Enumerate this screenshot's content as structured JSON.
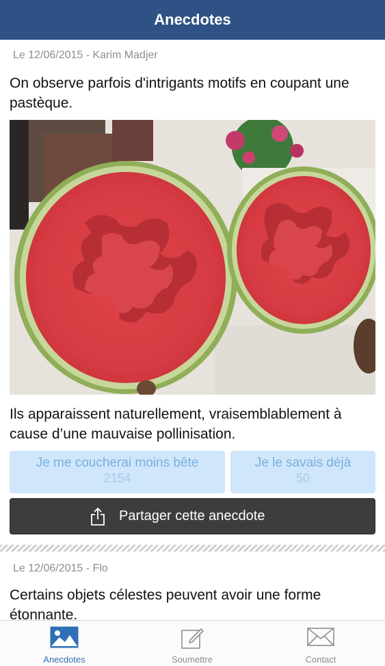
{
  "navbar": {
    "title": "Anecdotes"
  },
  "posts": [
    {
      "meta": "Le 12/06/2015 - Karim Madjer",
      "text": "On observe parfois d'intrigants motifs en coupant une pastèque.",
      "explanation": "Ils apparaissent naturellement, vraisemblablement à cause d’une mauvaise pollinisation.",
      "vote_learned": {
        "label": "Je me coucherai moins bête",
        "count": "2154"
      },
      "vote_known": {
        "label": "Je le savais déjà",
        "count": "50"
      },
      "share_label": "Partager cette anecdote"
    },
    {
      "meta": "Le 12/06/2015 - Flo",
      "text": "Certains objets célestes peuvent avoir une forme étonnante."
    }
  ],
  "tabbar": {
    "items": [
      {
        "label": "Anecdotes",
        "icon": "image-icon",
        "active": true
      },
      {
        "label": "Soumettre",
        "icon": "compose-icon",
        "active": false
      },
      {
        "label": "Contact",
        "icon": "mail-icon",
        "active": false
      }
    ]
  },
  "colors": {
    "navbar": "#2f5286",
    "accent": "#2f6fb6",
    "vote_bg": "#cfe6fb",
    "share_bg": "#3d3d3d"
  }
}
